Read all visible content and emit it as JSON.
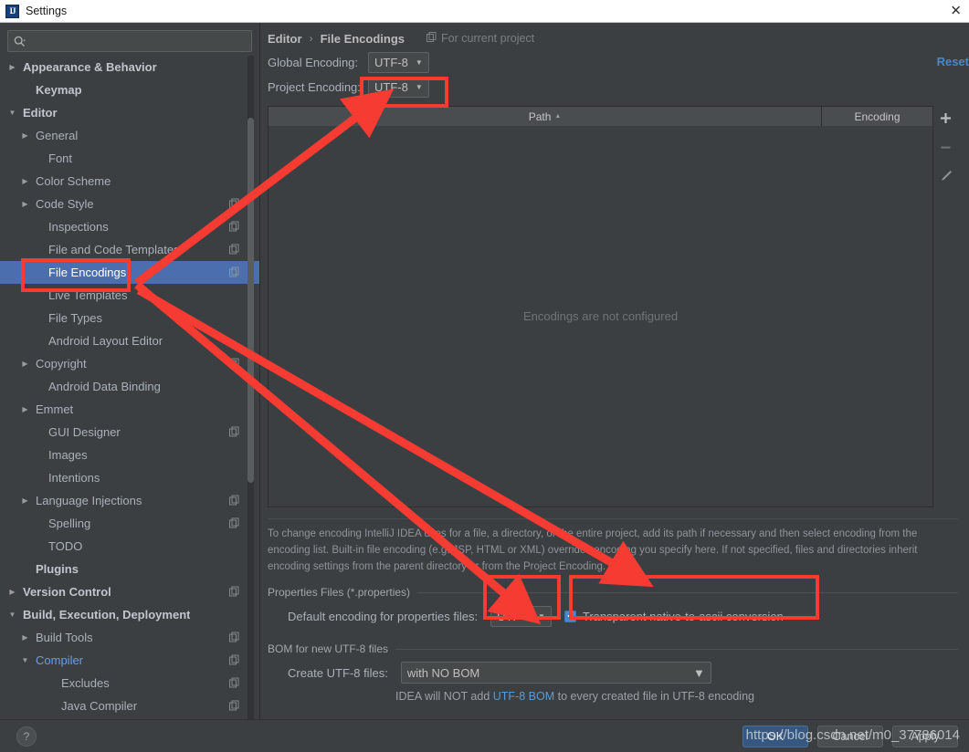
{
  "window": {
    "title": "Settings",
    "logo_text": "IJ",
    "close_label": "✕"
  },
  "sidebar": {
    "search": {
      "value": "",
      "placeholder": ""
    },
    "items": [
      {
        "label": "Appearance & Behavior",
        "arrow": "▶",
        "bold": true,
        "indent": 0,
        "copy": false,
        "selected": false,
        "blue": false
      },
      {
        "label": "Keymap",
        "arrow": "",
        "bold": true,
        "indent": 14,
        "copy": false,
        "selected": false,
        "blue": false
      },
      {
        "label": "Editor",
        "arrow": "▼",
        "bold": true,
        "indent": 0,
        "copy": false,
        "selected": false,
        "blue": false
      },
      {
        "label": "General",
        "arrow": "▶",
        "bold": false,
        "indent": 14,
        "copy": false,
        "selected": false,
        "blue": false
      },
      {
        "label": "Font",
        "arrow": "",
        "bold": false,
        "indent": 28,
        "copy": false,
        "selected": false,
        "blue": false
      },
      {
        "label": "Color Scheme",
        "arrow": "▶",
        "bold": false,
        "indent": 14,
        "copy": false,
        "selected": false,
        "blue": false
      },
      {
        "label": "Code Style",
        "arrow": "▶",
        "bold": false,
        "indent": 14,
        "copy": true,
        "selected": false,
        "blue": false
      },
      {
        "label": "Inspections",
        "arrow": "",
        "bold": false,
        "indent": 28,
        "copy": true,
        "selected": false,
        "blue": false
      },
      {
        "label": "File and Code Templates",
        "arrow": "",
        "bold": false,
        "indent": 28,
        "copy": true,
        "selected": false,
        "blue": false
      },
      {
        "label": "File Encodings",
        "arrow": "",
        "bold": false,
        "indent": 28,
        "copy": true,
        "selected": true,
        "blue": false
      },
      {
        "label": "Live Templates",
        "arrow": "",
        "bold": false,
        "indent": 28,
        "copy": false,
        "selected": false,
        "blue": false
      },
      {
        "label": "File Types",
        "arrow": "",
        "bold": false,
        "indent": 28,
        "copy": false,
        "selected": false,
        "blue": false
      },
      {
        "label": "Android Layout Editor",
        "arrow": "",
        "bold": false,
        "indent": 28,
        "copy": false,
        "selected": false,
        "blue": false
      },
      {
        "label": "Copyright",
        "arrow": "▶",
        "bold": false,
        "indent": 14,
        "copy": true,
        "selected": false,
        "blue": false
      },
      {
        "label": "Android Data Binding",
        "arrow": "",
        "bold": false,
        "indent": 28,
        "copy": false,
        "selected": false,
        "blue": false
      },
      {
        "label": "Emmet",
        "arrow": "▶",
        "bold": false,
        "indent": 14,
        "copy": false,
        "selected": false,
        "blue": false
      },
      {
        "label": "GUI Designer",
        "arrow": "",
        "bold": false,
        "indent": 28,
        "copy": true,
        "selected": false,
        "blue": false
      },
      {
        "label": "Images",
        "arrow": "",
        "bold": false,
        "indent": 28,
        "copy": false,
        "selected": false,
        "blue": false
      },
      {
        "label": "Intentions",
        "arrow": "",
        "bold": false,
        "indent": 28,
        "copy": false,
        "selected": false,
        "blue": false
      },
      {
        "label": "Language Injections",
        "arrow": "▶",
        "bold": false,
        "indent": 14,
        "copy": true,
        "selected": false,
        "blue": false
      },
      {
        "label": "Spelling",
        "arrow": "",
        "bold": false,
        "indent": 28,
        "copy": true,
        "selected": false,
        "blue": false
      },
      {
        "label": "TODO",
        "arrow": "",
        "bold": false,
        "indent": 28,
        "copy": false,
        "selected": false,
        "blue": false
      },
      {
        "label": "Plugins",
        "arrow": "",
        "bold": true,
        "indent": 14,
        "copy": false,
        "selected": false,
        "blue": false
      },
      {
        "label": "Version Control",
        "arrow": "▶",
        "bold": true,
        "indent": 0,
        "copy": true,
        "selected": false,
        "blue": false
      },
      {
        "label": "Build, Execution, Deployment",
        "arrow": "▼",
        "bold": true,
        "indent": 0,
        "copy": false,
        "selected": false,
        "blue": false
      },
      {
        "label": "Build Tools",
        "arrow": "▶",
        "bold": false,
        "indent": 14,
        "copy": true,
        "selected": false,
        "blue": false
      },
      {
        "label": "Compiler",
        "arrow": "▼",
        "bold": false,
        "indent": 14,
        "copy": true,
        "selected": false,
        "blue": true
      },
      {
        "label": "Excludes",
        "arrow": "",
        "bold": false,
        "indent": 42,
        "copy": true,
        "selected": false,
        "blue": false
      },
      {
        "label": "Java Compiler",
        "arrow": "",
        "bold": false,
        "indent": 42,
        "copy": true,
        "selected": false,
        "blue": false
      }
    ]
  },
  "main": {
    "breadcrumb": {
      "parent": "Editor",
      "separator": "›",
      "current": "File Encodings"
    },
    "scope_label": "For current project",
    "reset_label": "Reset",
    "global_encoding": {
      "label": "Global Encoding:",
      "value": "UTF-8"
    },
    "project_encoding": {
      "label": "Project Encoding:",
      "value": "UTF-8"
    },
    "table": {
      "columns": [
        "Path",
        "Encoding"
      ],
      "sort_indicator": "▲",
      "rows": [],
      "empty_message": "Encodings are not configured",
      "tools": [
        "add-icon",
        "remove-icon",
        "edit-icon"
      ]
    },
    "description": "To change encoding IntelliJ IDEA uses for a file, a directory, or the entire project, add its path if necessary and then select encoding from the encoding list. Built-in file encoding (e.g. JSP, HTML or XML) overrides encoding you specify here. If not specified, files and directories inherit encoding settings from the parent directory or from the Project Encoding.",
    "properties_group": {
      "title": "Properties Files (*.properties)",
      "default_encoding_label": "Default encoding for properties files:",
      "default_encoding_value": "UTF-8",
      "transparent_label": "Transparent native-to-ascii conversion",
      "transparent_checked": true,
      "check_glyph": "✓"
    },
    "bom_group": {
      "title": "BOM for new UTF-8 files",
      "create_label": "Create UTF-8 files:",
      "create_value": "with NO BOM",
      "note_prefix": "IDEA will NOT add ",
      "note_link": "UTF-8 BOM",
      "note_suffix": " to every created file in UTF-8 encoding"
    }
  },
  "footer": {
    "help_label": "?",
    "ok_label": "OK",
    "cancel_label": "Cancel",
    "apply_label": "Apply"
  },
  "watermark": {
    "text": "https://blog.csdn.net/m0_37786014"
  },
  "colors": {
    "accent_blue": "#4b6eaf",
    "link_blue": "#4a88c7",
    "annotation_red": "#f63b32",
    "panel_bg": "#3c3f41"
  }
}
